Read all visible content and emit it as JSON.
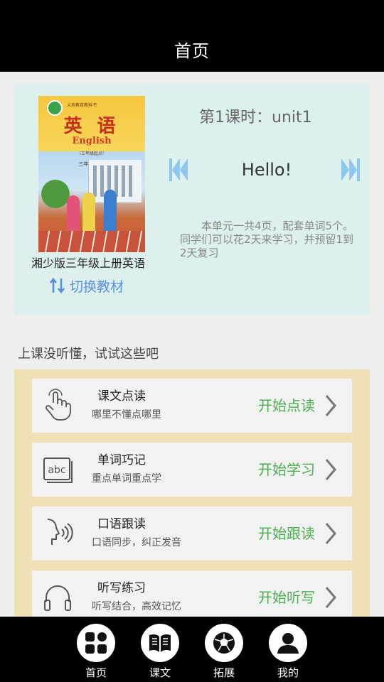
{
  "header": {
    "title": "首页"
  },
  "book": {
    "cover": {
      "series": "义务教育教科书",
      "title_cn": "英 语",
      "title_en": "English",
      "subtitle": "（三年级起点）",
      "grade": "三年级 上册"
    },
    "name": "湘少版三年级上册英语",
    "switch_label": "切换教材"
  },
  "lesson": {
    "title": "第1课时：unit1",
    "greeting": "Hello!",
    "description": "本单元一共4页，配套单词5个。同学们可以花2天来学习，并预留1到2天复习"
  },
  "section": {
    "label": "上课没听懂，试试这些吧"
  },
  "features": [
    {
      "icon": "hand-pointer-icon",
      "title": "课文点读",
      "subtitle": "哪里不懂点哪里",
      "action": "开始点读"
    },
    {
      "icon": "abc-card-icon",
      "title": "单词巧记",
      "subtitle": "重点单词重点学",
      "action": "开始学习"
    },
    {
      "icon": "speaking-head-icon",
      "title": "口语跟读",
      "subtitle": "口语同步，纠正发音",
      "action": "开始跟读"
    },
    {
      "icon": "headphones-icon",
      "title": "听写练习",
      "subtitle": "听写结合，高效记忆",
      "action": "开始听写"
    }
  ],
  "nav": [
    {
      "icon": "home-grid-icon",
      "label": "首页"
    },
    {
      "icon": "book-open-icon",
      "label": "课文"
    },
    {
      "icon": "soccer-ball-icon",
      "label": "拓展"
    },
    {
      "icon": "user-icon",
      "label": "我的"
    }
  ],
  "colors": {
    "header_bg": "#000000",
    "panel_bg": "#dcf0ee",
    "cards_bg": "#efe0b5",
    "action_green": "#4caf50",
    "switch_blue": "#5b8fe0",
    "arrow_blue": "#8ec6ee"
  }
}
